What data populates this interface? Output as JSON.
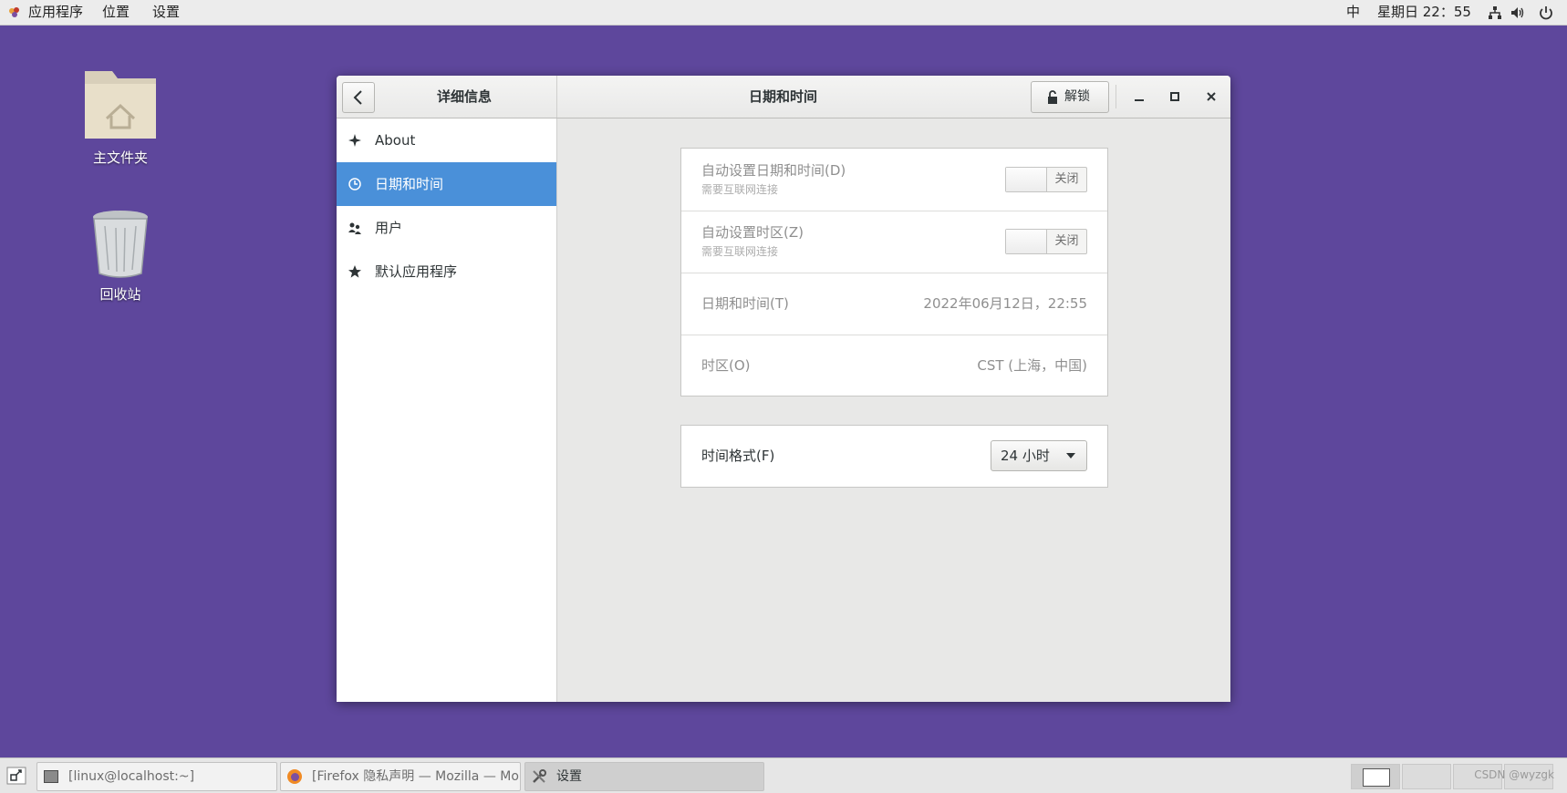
{
  "top_bar": {
    "menus": [
      "应用程序",
      "位置",
      "设置"
    ],
    "input_method": "中",
    "clock": "星期日 22：55",
    "icons": [
      "network-icon",
      "volume-icon",
      "power-icon"
    ]
  },
  "desktop": {
    "icons": [
      {
        "label": "主文件夹",
        "icon": "home-folder-icon"
      },
      {
        "label": "回收站",
        "icon": "trash-icon"
      }
    ]
  },
  "window": {
    "sidebar_title": "详细信息",
    "title": "日期和时间",
    "unlock_label": "解锁",
    "sidebar": {
      "items": [
        {
          "label": "About",
          "icon": "sparkle-icon",
          "active": false
        },
        {
          "label": "日期和时间",
          "icon": "clock-icon",
          "active": true
        },
        {
          "label": "用户",
          "icon": "users-icon",
          "active": false
        },
        {
          "label": "默认应用程序",
          "icon": "star-icon",
          "active": false
        }
      ]
    },
    "settings": {
      "auto_datetime": {
        "label": "自动设置日期和时间(D)",
        "sublabel": "需要互联网连接",
        "state": "关闭"
      },
      "auto_timezone": {
        "label": "自动设置时区(Z)",
        "sublabel": "需要互联网连接",
        "state": "关闭"
      },
      "datetime": {
        "label": "日期和时间(T)",
        "value": "2022年06月12日，22:55"
      },
      "timezone": {
        "label": "时区(O)",
        "value": "CST (上海，中国)"
      },
      "time_format": {
        "label": "时间格式(F)",
        "value": "24 小时"
      }
    }
  },
  "taskbar": {
    "tasks": [
      {
        "label": "[linux@localhost:~]",
        "icon": "terminal-icon",
        "active": false
      },
      {
        "label": "[Firefox 隐私声明 — Mozilla — Mo···",
        "icon": "firefox-icon",
        "active": false
      },
      {
        "label": "设置",
        "icon": "settings-tools-icon",
        "active": true
      }
    ],
    "watermark": "CSDN @wyzgk"
  },
  "colors": {
    "desktop_bg": "#5e479c",
    "accent": "#4a90d9"
  }
}
